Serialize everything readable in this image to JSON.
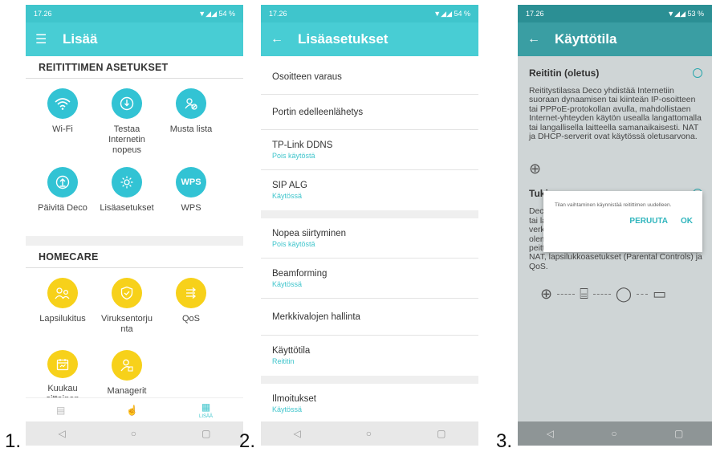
{
  "captions": [
    "1.",
    "2.",
    "3."
  ],
  "panel1": {
    "status": {
      "time": "17.26",
      "right": "▼◢◢ 54 %"
    },
    "title": "Lisää",
    "section1": "REITITTIMEN ASETUKSET",
    "router_tiles": [
      {
        "label": "Wi-Fi",
        "icon": "wifi-icon"
      },
      {
        "label": "Testaa\nInternetin\nnopeus",
        "icon": "speedtest-icon"
      },
      {
        "label": "Musta lista",
        "icon": "blacklist-icon"
      },
      {
        "label": "Päivitä Deco",
        "icon": "update-icon"
      },
      {
        "label": "Lisäasetukset",
        "icon": "advanced-settings-icon"
      },
      {
        "label": "WPS",
        "icon": "wps-icon",
        "text": "WPS"
      }
    ],
    "section2": "HOMECARE",
    "homecare_tiles": [
      {
        "label": "Lapsilukitus",
        "icon": "parental-controls-icon"
      },
      {
        "label": "Viruksentorju\nnta",
        "icon": "antivirus-icon"
      },
      {
        "label": "QoS",
        "icon": "qos-icon"
      },
      {
        "label": "Kuukau\nsittainen",
        "icon": "monthly-report-icon"
      },
      {
        "label": "Managerit",
        "icon": "managers-icon"
      }
    ],
    "tabs": [
      {
        "icon": "overview-icon",
        "label": ""
      },
      {
        "icon": "touch-icon",
        "label": ""
      },
      {
        "icon": "more-grid-icon",
        "label": "LISÄÄ"
      }
    ]
  },
  "panel2": {
    "status": {
      "time": "17.26",
      "right": "▼◢◢ 54 %"
    },
    "title": "Lisäasetukset",
    "rows": [
      {
        "title": "Osoitteen varaus",
        "sub": ""
      },
      {
        "title": "Portin edelleenlähetys",
        "sub": ""
      },
      {
        "title": "TP-Link DDNS",
        "sub": "Pois käytöstä"
      },
      {
        "title": "SIP ALG",
        "sub": "Käytössä"
      },
      {
        "title": "Nopea siirtyminen",
        "sub": "Pois käytöstä"
      },
      {
        "title": "Beamforming",
        "sub": "Käytössä"
      },
      {
        "title": "Merkkivalojen hallinta",
        "sub": ""
      },
      {
        "title": "Käyttötila",
        "sub": "Reititin"
      },
      {
        "title": "Ilmoitukset",
        "sub": "Käytössä"
      }
    ]
  },
  "panel3": {
    "status": {
      "time": "17.26",
      "right": "▼◢◢ 53 %"
    },
    "title": "Käyttötila",
    "router_heading": "Reititin (oletus)",
    "router_text": "Reititystilassa Deco yhdistää Internetiin suoraan dynaamisen tai kiinteän IP-osoitteen tai PPPoE-protokollan avulla, mahdollistaen Internet-yhteyden käytön usealla langattomalla tai langallisella laitteella samanaikaisesti. NAT ja DHCP-serverit ovat käytössä oletusarvona.",
    "ap_heading": "Tukiasema",
    "ap_text": "Deco yhdistää tukiasematilassa langalliseen tai langattomaan reitittimeen joko verkkokaapelin kautta tai laajentamalla olemassa olevan langattoman verkkosi peittoa. Tässä tilassa ei tueta toimintoja, kuten NAT, lapsilukkoasetukset (Parental Controls) ja QoS.",
    "dialog": {
      "message": "Tilan vaihtaminen käynnistää reitittimen uudelleen.",
      "cancel": "PERUUTA",
      "ok": "OK"
    }
  },
  "sysnav": {
    "back": "◁",
    "home": "○",
    "recent": "▢"
  }
}
